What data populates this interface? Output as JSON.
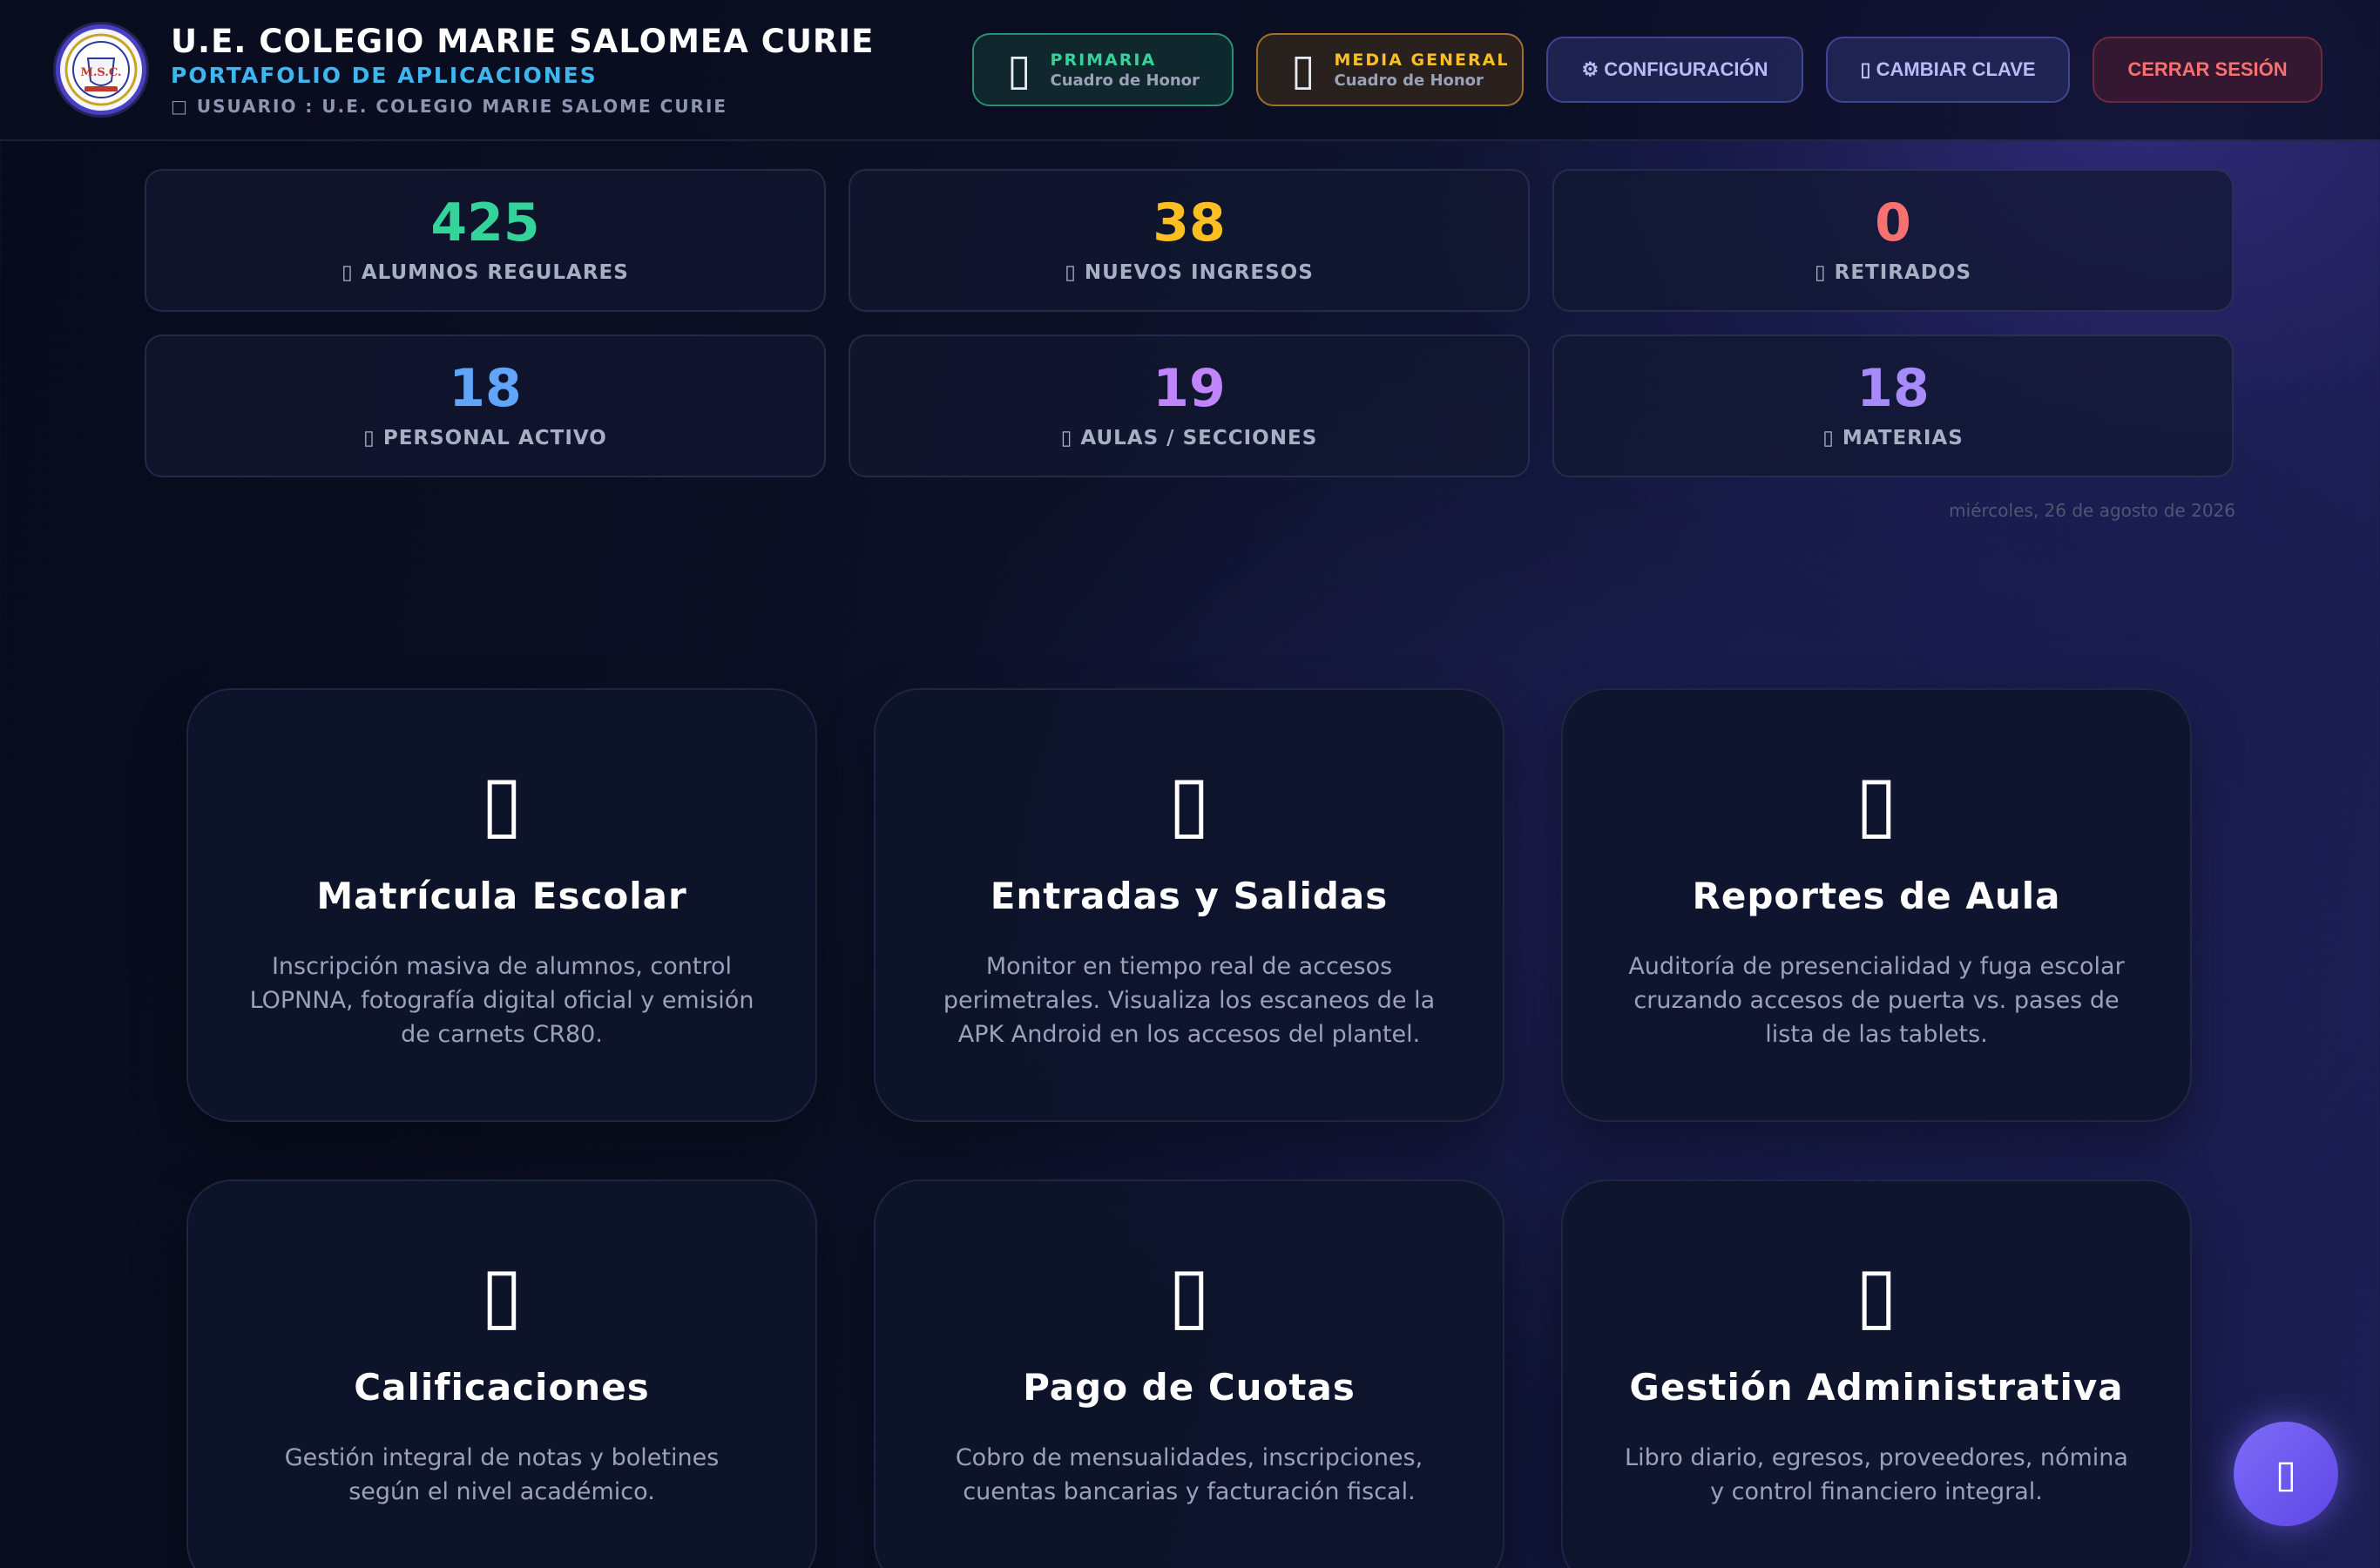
{
  "header": {
    "school_name": "U.E. COLEGIO MARIE SALOMEA CURIE",
    "portfolio_label": "PORTAFOLIO DE APLICACIONES",
    "user_line": "□ USUARIO : U.E. COLEGIO MARIE SALOME CURIE",
    "logo_text": "M.S.C.",
    "buttons": {
      "primaria": {
        "icon": "▯",
        "title": "PRIMARIA",
        "subtitle": "Cuadro de Honor"
      },
      "media": {
        "icon": "▯",
        "title": "MEDIA GENERAL",
        "subtitle": "Cuadro de Honor"
      },
      "config": "⚙ CONFIGURACIÓN",
      "clave": "▯ CAMBIAR CLAVE",
      "logout": "CERRAR SESIÓN"
    }
  },
  "stats": [
    {
      "value": "425",
      "label": "▯ ALUMNOS REGULARES",
      "color": "#34d399"
    },
    {
      "value": "38",
      "label": "▯ NUEVOS INGRESOS",
      "color": "#fbbf24"
    },
    {
      "value": "0",
      "label": "▯ RETIRADOS",
      "color": "#f87171"
    },
    {
      "value": "18",
      "label": "▯ PERSONAL ACTIVO",
      "color": "#60a5fa"
    },
    {
      "value": "19",
      "label": "▯ AULAS / SECCIONES",
      "color": "#c084fc"
    },
    {
      "value": "18",
      "label": "▯ MATERIAS",
      "color": "#a78bfa"
    }
  ],
  "date": "miércoles, 26 de agosto de 2026",
  "modules": [
    {
      "icon": "▯",
      "title": "Matrícula Escolar",
      "description": "Inscripción masiva de alumnos, control LOPNNA, fotografía digital oficial y emisión de carnets CR80."
    },
    {
      "icon": "▯",
      "title": "Entradas y Salidas",
      "description": "Monitor en tiempo real de accesos perimetrales. Visualiza los escaneos de la APK Android en los accesos del plantel."
    },
    {
      "icon": "▯",
      "title": "Reportes de Aula",
      "description": "Auditoría de presencialidad y fuga escolar cruzando accesos de puerta vs. pases de lista de las tablets."
    },
    {
      "icon": "▯",
      "title": "Calificaciones",
      "description": "Gestión integral de notas y boletines según el nivel académico."
    },
    {
      "icon": "▯",
      "title": "Pago de Cuotas",
      "description": "Cobro de mensualidades, inscripciones, cuentas bancarias y facturación fiscal."
    },
    {
      "icon": "▯",
      "title": "Gestión Administrativa",
      "description": "Libro diario, egresos, proveedores, nómina y control financiero integral."
    }
  ],
  "fab": {
    "icon": "▯"
  },
  "colors": {
    "accent": "#3fb6f0",
    "danger": "#f87171",
    "fab": "#6d5cf0"
  }
}
